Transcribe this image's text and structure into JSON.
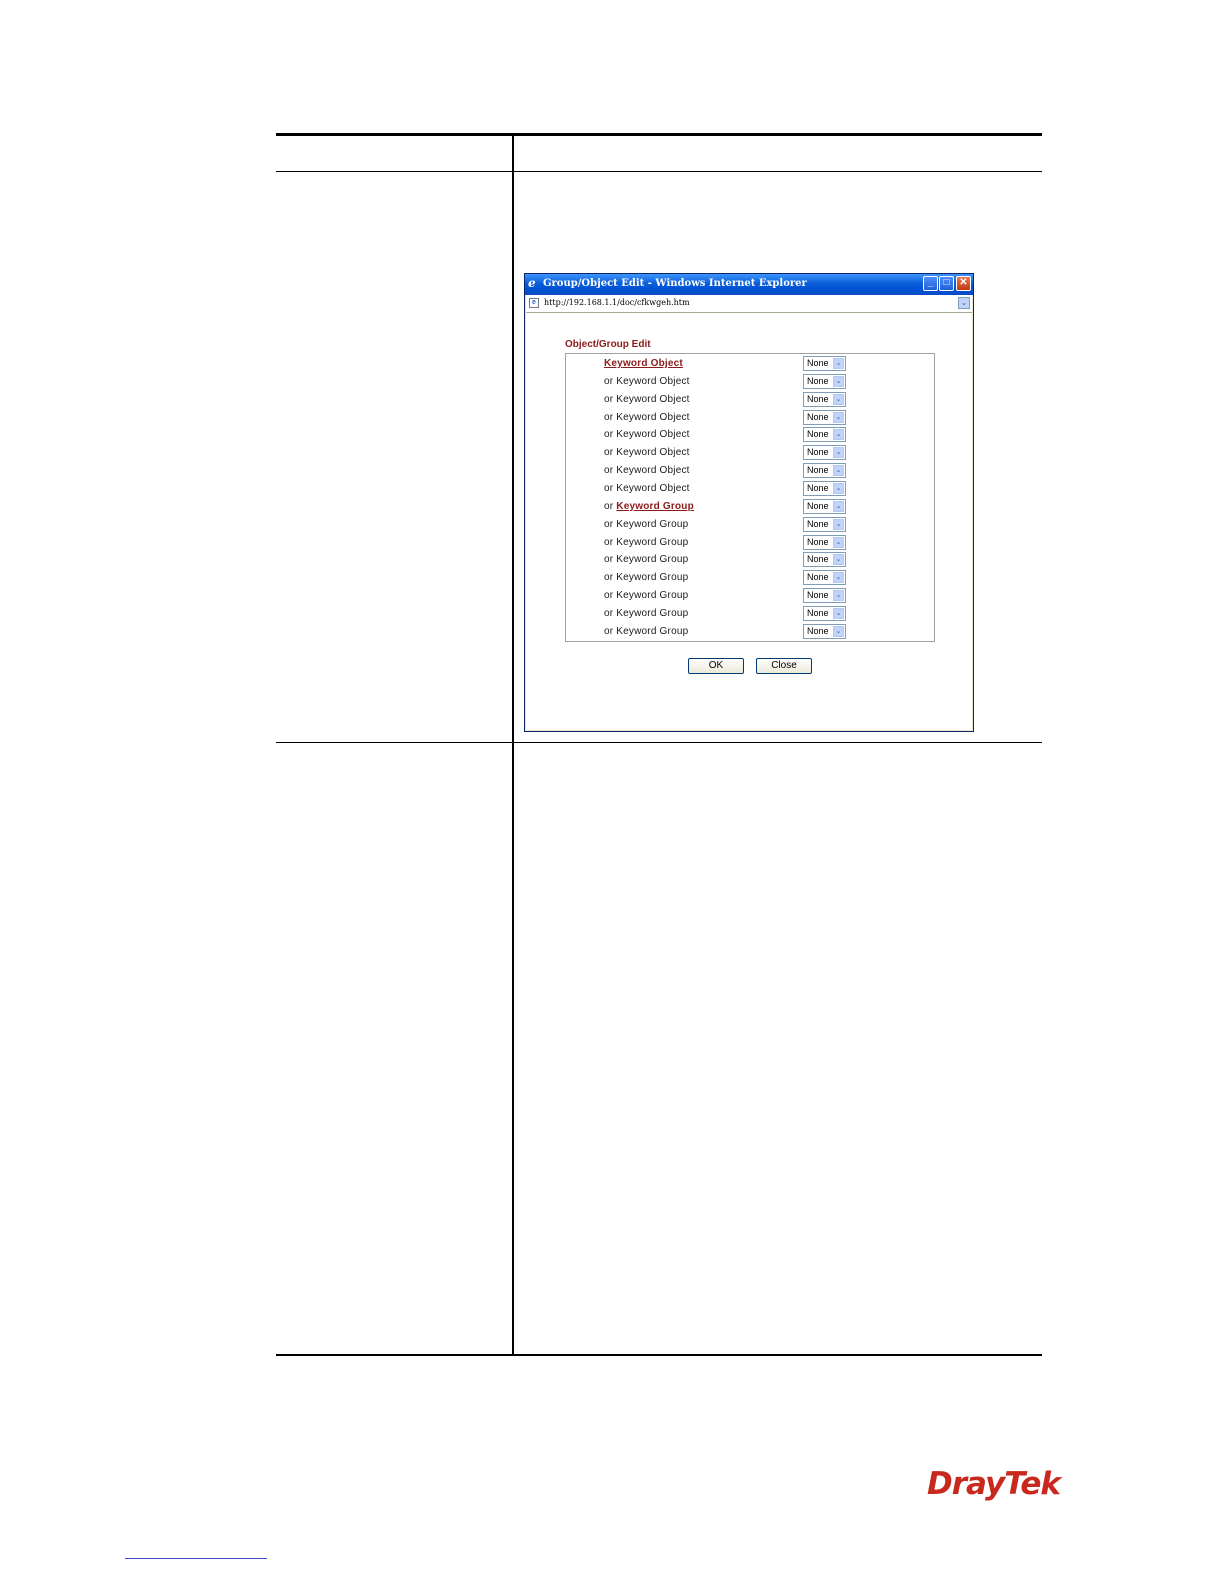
{
  "window": {
    "title": "Group/Object Edit - Windows Internet Explorer",
    "address": "http://192.168.1.1/doc/cfkwgeh.htm",
    "buttons": {
      "minimize": "_",
      "maximize": "□",
      "close": "✕"
    }
  },
  "form": {
    "title": "Object/Group Edit",
    "rows": [
      {
        "prefix": "",
        "label": "Keyword Object",
        "link": true,
        "value": "None"
      },
      {
        "prefix": "",
        "label": "or Keyword Object",
        "link": false,
        "value": "None"
      },
      {
        "prefix": "",
        "label": "or Keyword Object",
        "link": false,
        "value": "None"
      },
      {
        "prefix": "",
        "label": "or Keyword Object",
        "link": false,
        "value": "None"
      },
      {
        "prefix": "",
        "label": "or Keyword Object",
        "link": false,
        "value": "None"
      },
      {
        "prefix": "",
        "label": "or Keyword Object",
        "link": false,
        "value": "None"
      },
      {
        "prefix": "",
        "label": "or Keyword Object",
        "link": false,
        "value": "None"
      },
      {
        "prefix": "",
        "label": "or Keyword Object",
        "link": false,
        "value": "None"
      },
      {
        "prefix": "or ",
        "label": "Keyword Group",
        "link": true,
        "value": "None"
      },
      {
        "prefix": "",
        "label": "or Keyword Group",
        "link": false,
        "value": "None"
      },
      {
        "prefix": "",
        "label": "or Keyword Group",
        "link": false,
        "value": "None"
      },
      {
        "prefix": "",
        "label": "or Keyword Group",
        "link": false,
        "value": "None"
      },
      {
        "prefix": "",
        "label": "or Keyword Group",
        "link": false,
        "value": "None"
      },
      {
        "prefix": "",
        "label": "or Keyword Group",
        "link": false,
        "value": "None"
      },
      {
        "prefix": "",
        "label": "or Keyword Group",
        "link": false,
        "value": "None"
      },
      {
        "prefix": "",
        "label": "or Keyword Group",
        "link": false,
        "value": "None"
      }
    ],
    "ok_label": "OK",
    "close_label": "Close"
  },
  "footer": {
    "logo_text": "DrayTek"
  },
  "colors": {
    "accent": "#8b1a1a",
    "logo": "#c8281e",
    "titlebar": "#0a5fd8"
  },
  "icons": {
    "window": "ie-logo-icon",
    "address": "page-icon",
    "dropdown": "chevron-down-icon"
  }
}
